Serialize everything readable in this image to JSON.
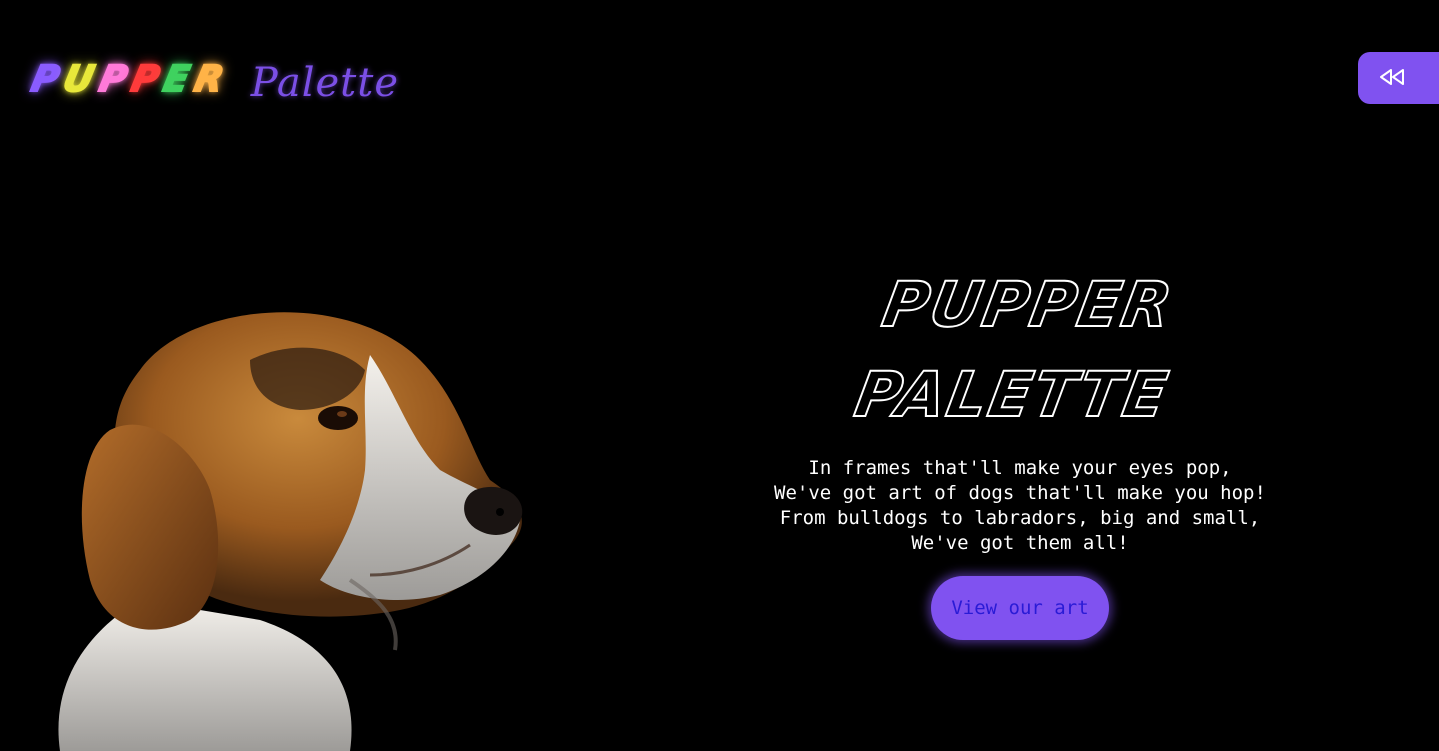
{
  "header": {
    "logo_letters": [
      {
        "char": "P",
        "color": "#8a5cff"
      },
      {
        "char": "U",
        "color": "#e8e83a"
      },
      {
        "char": "P",
        "color": "#ff7ad9"
      },
      {
        "char": "P",
        "color": "#ff3b3b"
      },
      {
        "char": "E",
        "color": "#3fd25f"
      },
      {
        "char": "R",
        "color": "#ffb347"
      }
    ],
    "logo_script": "Palette",
    "rewind_icon": "rewind-icon"
  },
  "hero": {
    "title_line1": "Pupper",
    "title_line2": "Palette",
    "poem": "In frames that'll make your eyes pop,\nWe've got art of dogs that'll make you hop!\nFrom bulldogs to labradors, big and small,\nWe've got them all!",
    "cta_label": "View our art"
  },
  "colors": {
    "background": "#000000",
    "accent": "#8052f0",
    "cta_text": "#2a1bd6"
  }
}
